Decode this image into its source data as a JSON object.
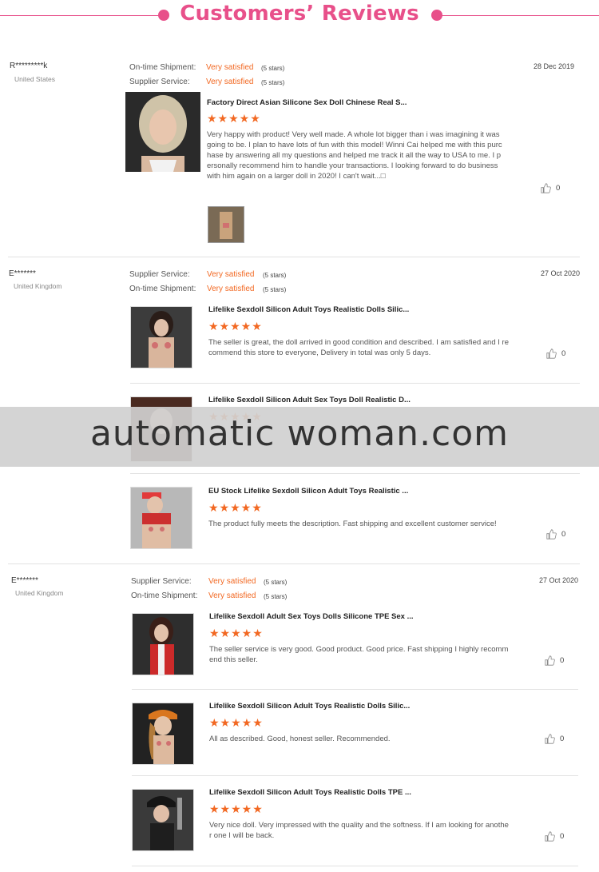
{
  "header": {
    "title": "Customers’ Reviews"
  },
  "colors": {
    "accent_pink": "#e8508a",
    "rating_orange": "#f26822"
  },
  "reviews": [
    {
      "buyer": "R*********k",
      "country": "United States",
      "date": "28 Dec 2019",
      "rating1_label": "On-time Shipment:",
      "rating1_value": "Very satisfied",
      "rating1_stars": "(5 stars)",
      "rating2_label": "Supplier Service:",
      "rating2_value": "Very satisfied",
      "rating2_stars": "(5 stars)",
      "items": [
        {
          "title": "Factory Direct Asian Silicone Sex Doll Chinese Real S...",
          "stars": "★★★★★",
          "text": "Very happy with product!  Very well made.  A whole lot bigger than i was imagining it was going to be.  I plan to have lots of fun with this model!  Winni Cai helped me with this purchase by answering all my questions and helped me track it all the way to USA to me.  I personally recommend him to handle your transactions.  I looking forward to do business with him again on a larger doll in 2020!  I can't wait...□",
          "likes": "0"
        }
      ]
    },
    {
      "buyer": "E*******",
      "country": "United Kingdom",
      "date": "27 Oct 2020",
      "rating1_label": "Supplier Service:",
      "rating1_value": "Very satisfied",
      "rating1_stars": "(5 stars)",
      "rating2_label": "On-time Shipment:",
      "rating2_value": "Very satisfied",
      "rating2_stars": "(5 stars)",
      "items": [
        {
          "title": "Lifelike Sexdoll Silicon Adult Toys Realistic Dolls Silic...",
          "stars": "★★★★★",
          "text": "The seller is great, the doll arrived in good condition and described. I am satisfied and I recommend this store to everyone, Delivery in total was only 5 days.",
          "likes": "0"
        },
        {
          "title": "Lifelike Sexdoll Silicon Adult Sex Toys Doll Realistic D...",
          "stars": "★★★★★",
          "text": "",
          "likes": "0"
        },
        {
          "title": "EU Stock Lifelike Sexdoll Silicon Adult Toys Realistic ...",
          "stars": "★★★★★",
          "text": "The product fully meets the description. Fast shipping and excellent customer service!",
          "likes": "0"
        }
      ]
    },
    {
      "buyer": "E*******",
      "country": "United Kingdom",
      "date": "27 Oct 2020",
      "rating1_label": "Supplier Service:",
      "rating1_value": "Very satisfied",
      "rating1_stars": "(5 stars)",
      "rating2_label": "On-time Shipment:",
      "rating2_value": "Very satisfied",
      "rating2_stars": "(5 stars)",
      "items": [
        {
          "title": "Lifelike Sexdoll Adult Sex Toys Dolls Silicone TPE Sex ...",
          "stars": "★★★★★",
          "text": "The seller service is very good. Good product. Good price. Fast shipping I highly recommend this seller.",
          "likes": "0"
        },
        {
          "title": "Lifelike Sexdoll Silicon Adult Toys Realistic Dolls Silic...",
          "stars": "★★★★★",
          "text": "All as described. Good, honest seller. Recommended.",
          "likes": "0"
        },
        {
          "title": "Lifelike Sexdoll Silicon Adult Toys Realistic Dolls TPE ...",
          "stars": "★★★★★",
          "text": "Very nice doll. Very impressed with the quality and the softness. If I am looking for another one I will be back.",
          "likes": "0"
        }
      ]
    }
  ],
  "watermark": "automatic woman.com"
}
